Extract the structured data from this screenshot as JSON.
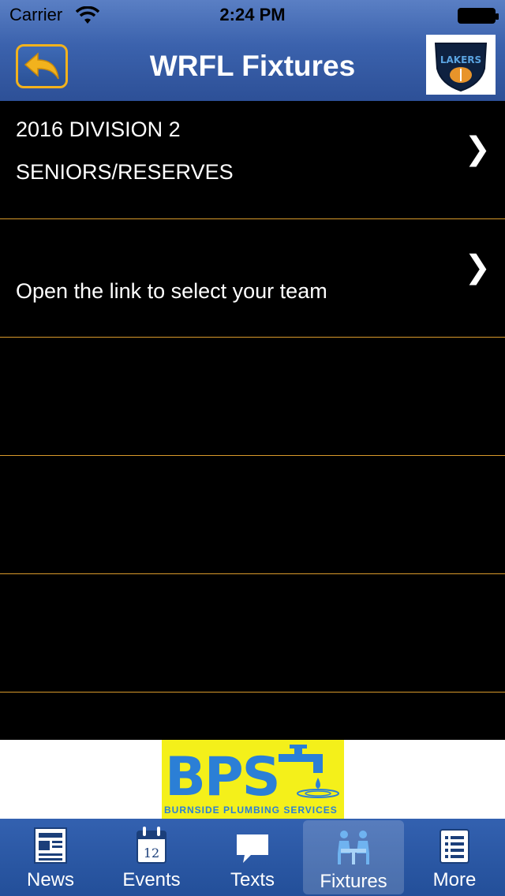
{
  "status_bar": {
    "carrier": "Carrier",
    "time": "2:24 PM"
  },
  "nav": {
    "title": "WRFL Fixtures",
    "logo_text": "LAKERS"
  },
  "rows": [
    {
      "line1": "2016 DIVISION 2",
      "line2": "SENIORS/RESERVES",
      "chevron": "❯"
    },
    {
      "line1": "Open the link to select your team",
      "chevron": "❯"
    },
    {},
    {},
    {}
  ],
  "ad": {
    "brand": "BPS",
    "tagline": "BURNSIDE PLUMBING SERVICES",
    "colors": {
      "bg": "#f4f01a",
      "text": "#2b7fd6"
    }
  },
  "tabs": [
    {
      "label": "News",
      "icon": "newspaper-icon"
    },
    {
      "label": "Events",
      "icon": "calendar-icon",
      "icon_text": "12"
    },
    {
      "label": "Texts",
      "icon": "speech-bubble-icon"
    },
    {
      "label": "Fixtures",
      "icon": "people-table-icon",
      "active": true
    },
    {
      "label": "More",
      "icon": "list-icon"
    }
  ],
  "colors": {
    "nav_bg": "#3b62ad",
    "accent": "#f2b21d",
    "separator": "#d99a2b"
  }
}
